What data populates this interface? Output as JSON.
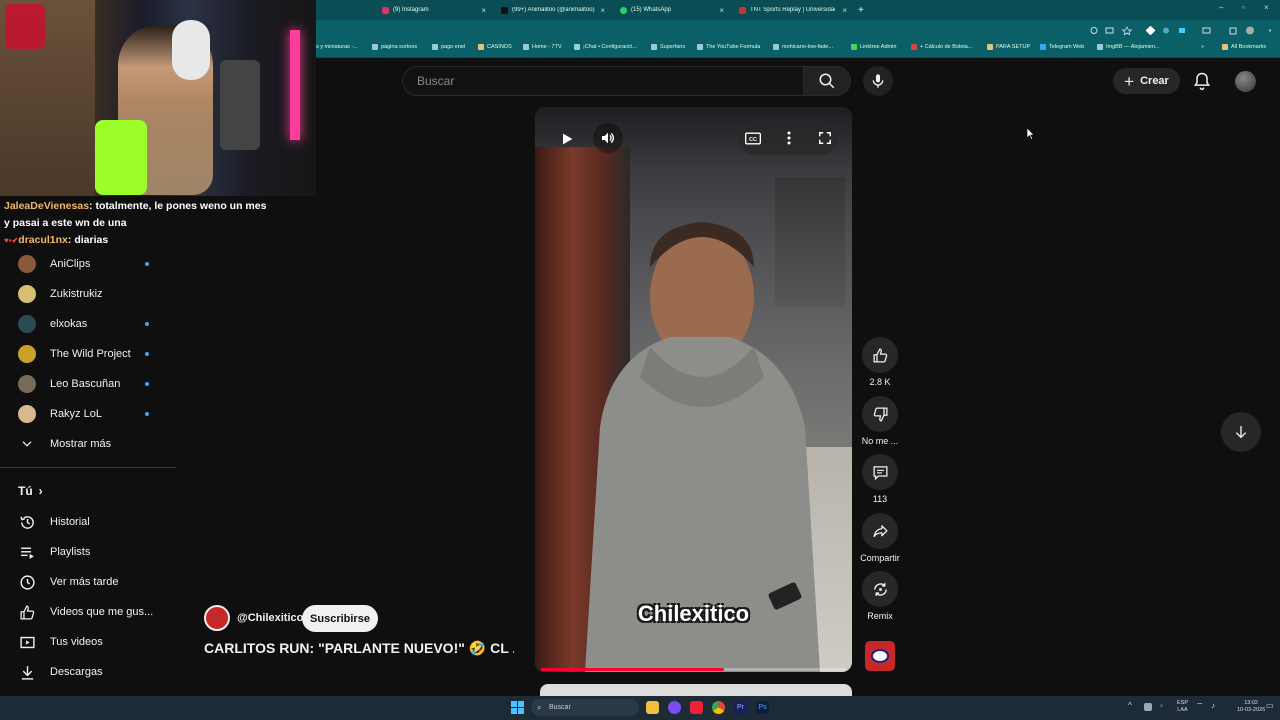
{
  "browser": {
    "tabs": [
      {
        "title": "(9) Instagram",
        "color": "#e1306c"
      },
      {
        "title": "(99+) Animalitoo (@animalitoo)",
        "color": "#111111"
      },
      {
        "title": "(15) WhatsApp",
        "color": "#25d366"
      },
      {
        "title": "TNT Sports Replay | Universidad",
        "color": "#d32f2f"
      }
    ],
    "bookmarks": [
      "s y miniaturas -...",
      "página sorteos",
      "pago enel",
      "CASINOS",
      "Home - 7TV",
      "¡Chat • Configuració...",
      "Superfans",
      "The YouTube Formula",
      "mohicano-low-fade...",
      "Linktree Admin",
      "+ Cálculo de Boleta...",
      "PARA SETUP",
      "Telegram Web",
      "ImgBB — Alojamien..."
    ],
    "all_bookmarks": "All Bookmarks"
  },
  "header": {
    "search_placeholder": "Buscar",
    "create_label": "Crear"
  },
  "chat": {
    "line1_user": "JaleaDeVienesas",
    "line1_text": " totalmente, le pones weno un mes",
    "line2_text": "y pasai a este wn de una",
    "line3_user": "dracul1nx",
    "line3_text": " diarias"
  },
  "sidebar": {
    "subscriptions": [
      {
        "name": "AniClips",
        "color": "#8b5a3c",
        "live": true
      },
      {
        "name": "Zukistrukiz",
        "color": "#d4c070",
        "live": false
      },
      {
        "name": "elxokas",
        "color": "#2c4a52",
        "live": true
      },
      {
        "name": "The Wild Project",
        "color": "#c9a227",
        "live": true
      },
      {
        "name": "Leo Bascuñan",
        "color": "#7a6a5a",
        "live": true
      },
      {
        "name": "Rakyz LoL",
        "color": "#d8b890",
        "live": true
      }
    ],
    "show_more": "Mostrar más",
    "you_section": "Tú",
    "you_items": [
      {
        "label": "Historial",
        "icon": "history-icon"
      },
      {
        "label": "Playlists",
        "icon": "playlists-icon"
      },
      {
        "label": "Ver más tarde",
        "icon": "watch-later-icon"
      },
      {
        "label": "Videos que me gus...",
        "icon": "liked-icon"
      },
      {
        "label": "Tus videos",
        "icon": "your-videos-icon"
      },
      {
        "label": "Descargas",
        "icon": "downloads-icon"
      }
    ]
  },
  "video": {
    "caption": "Chilexitico",
    "progress": 0.6,
    "channel": "@Chilexitico",
    "subscribe_label": "Suscribirse",
    "title": "CARLITOS RUN: \"PARLANTE NUEVO!\" 🤣 CL ..."
  },
  "actions": {
    "like_count": "2.8 K",
    "dislike_label": "No me ...",
    "comments_count": "113",
    "share_label": "Compartir",
    "remix_label": "Remix"
  },
  "taskbar": {
    "search_label": "Buscar",
    "lang": "ESP\nLAA",
    "time": "13:02",
    "date": "10-03-2026"
  },
  "colors": {
    "accent_red": "#ff0033",
    "live_dot": "#3ea6ff",
    "browser_frame": "#0b5f66"
  }
}
